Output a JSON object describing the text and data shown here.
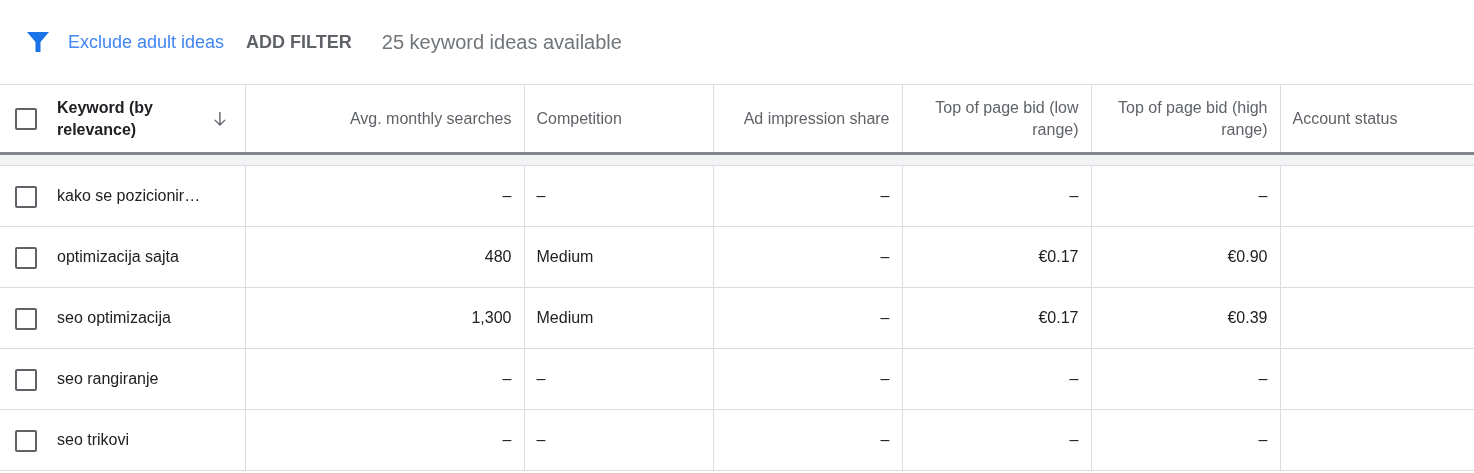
{
  "toolbar": {
    "filter_link": "Exclude adult ideas",
    "add_filter": "ADD FILTER",
    "summary": "25 keyword ideas available"
  },
  "table": {
    "select_all": {
      "checked": false
    },
    "columns": [
      {
        "label": "Keyword (by relevance)",
        "kind": "text",
        "sorted": true
      },
      {
        "label": "Avg. monthly searches",
        "kind": "numeric",
        "sorted": false
      },
      {
        "label": "Competition",
        "kind": "text",
        "sorted": false
      },
      {
        "label": "Ad impression share",
        "kind": "numeric",
        "sorted": false
      },
      {
        "label": "Top of page bid (low range)",
        "kind": "numeric",
        "sorted": false
      },
      {
        "label": "Top of page bid (high range)",
        "kind": "numeric",
        "sorted": false
      },
      {
        "label": "Account status",
        "kind": "text",
        "sorted": false
      }
    ],
    "rows": [
      {
        "checked": false,
        "cells": [
          "kako se pozicionir…",
          "–",
          "–",
          "–",
          "–",
          "–",
          ""
        ]
      },
      {
        "checked": false,
        "cells": [
          "optimizacija sajta",
          "480",
          "Medium",
          "–",
          "€0.17",
          "€0.90",
          ""
        ]
      },
      {
        "checked": false,
        "cells": [
          "seo optimizacija",
          "1,300",
          "Medium",
          "–",
          "€0.17",
          "€0.39",
          ""
        ]
      },
      {
        "checked": false,
        "cells": [
          "seo rangiranje",
          "–",
          "–",
          "–",
          "–",
          "–",
          ""
        ]
      },
      {
        "checked": false,
        "cells": [
          "seo trikovi",
          "–",
          "–",
          "–",
          "–",
          "–",
          ""
        ]
      }
    ]
  }
}
